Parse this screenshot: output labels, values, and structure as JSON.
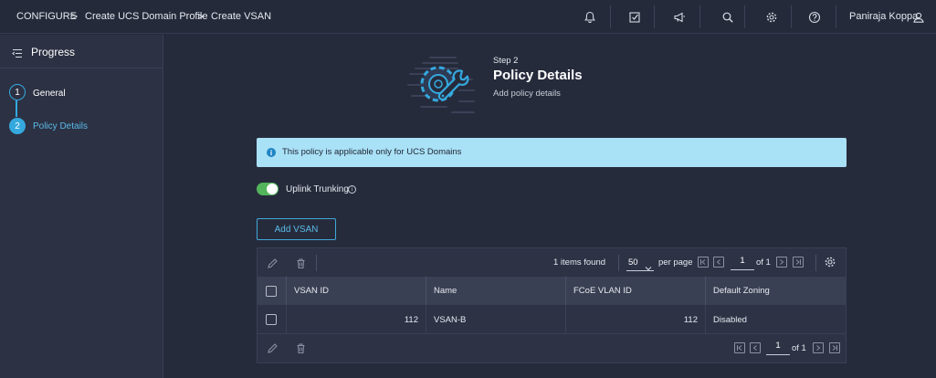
{
  "breadcrumb": {
    "items": [
      "CONFIGURE",
      "Create UCS Domain Profile",
      "Create VSAN"
    ],
    "separator": ">"
  },
  "topbar": {
    "icons": [
      "bell-icon",
      "task-check-icon",
      "megaphone-icon",
      "search-icon",
      "gear-icon",
      "help-icon"
    ],
    "user_name": "Paniraja Koppa"
  },
  "sidebar": {
    "title": "Progress",
    "steps": [
      {
        "number": "1",
        "label": "General",
        "state": "completed"
      },
      {
        "number": "2",
        "label": "Policy Details",
        "state": "active"
      }
    ]
  },
  "hero": {
    "step": "Step 2",
    "title": "Policy Details",
    "subtitle": "Add policy details"
  },
  "banner": {
    "text": "This policy is applicable only for UCS Domains"
  },
  "uplink": {
    "label": "Uplink Trunking",
    "enabled": true
  },
  "actions": {
    "add_label": "Add VSAN"
  },
  "table": {
    "items_found": "1 items found",
    "per_page_value": "50",
    "per_page_label": "per page",
    "page": "1",
    "of_pages": "of 1",
    "columns": [
      "VSAN ID",
      "Name",
      "FCoE VLAN ID",
      "Default Zoning"
    ],
    "rows": [
      {
        "vsan_id": "112",
        "name": "VSAN-B",
        "fcoe_vlan_id": "112",
        "default_zoning": "Disabled"
      }
    ]
  },
  "colors": {
    "accent": "#35a9de",
    "banner_bg": "#a9e1f6",
    "toggle_on": "#53b45b",
    "background": "#262b3c"
  }
}
